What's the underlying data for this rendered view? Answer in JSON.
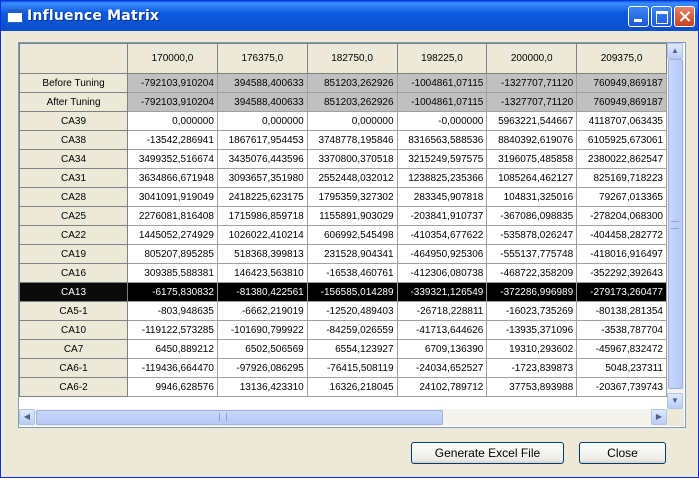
{
  "window": {
    "title": "Influence Matrix"
  },
  "columns": [
    "170000,0",
    "176375,0",
    "182750,0",
    "198225,0",
    "200000,0",
    "209375,0"
  ],
  "rows": [
    {
      "label": "Before Tuning",
      "values": [
        "-792103,910204",
        "394588,400633",
        "851203,262926",
        "-1004861,07115",
        "-1327707,71120",
        "760949,869187"
      ]
    },
    {
      "label": "After Tuning",
      "values": [
        "-792103,910204",
        "394588,400633",
        "851203,262926",
        "-1004861,07115",
        "-1327707,71120",
        "760949,869187"
      ]
    },
    {
      "label": "CA39",
      "values": [
        "0,000000",
        "0,000000",
        "0,000000",
        "-0,000000",
        "5963221,544667",
        "4118707,063435"
      ]
    },
    {
      "label": "CA38",
      "values": [
        "-13542,286941",
        "1867617,954453",
        "3748778,195846",
        "8316563,588536",
        "8840392,619076",
        "6105925,673061"
      ]
    },
    {
      "label": "CA34",
      "values": [
        "3499352,516674",
        "3435076,443596",
        "3370800,370518",
        "3215249,597575",
        "3196075,485858",
        "2380022,862547"
      ]
    },
    {
      "label": "CA31",
      "values": [
        "3634866,671948",
        "3093657,351980",
        "2552448,032012",
        "1238825,235366",
        "1085264,462127",
        "825169,718223"
      ]
    },
    {
      "label": "CA28",
      "values": [
        "3041091,919049",
        "2418225,623175",
        "1795359,327302",
        "283345,907818",
        "104831,325016",
        "79267,013365"
      ]
    },
    {
      "label": "CA25",
      "values": [
        "2276081,816408",
        "1715986,859718",
        "1155891,903029",
        "-203841,910737",
        "-367086,098835",
        "-278204,068300"
      ]
    },
    {
      "label": "CA22",
      "values": [
        "1445052,274929",
        "1026022,410214",
        "606992,545498",
        "-410354,677622",
        "-535878,026247",
        "-404458,282772"
      ]
    },
    {
      "label": "CA19",
      "values": [
        "805207,895285",
        "518368,399813",
        "231528,904341",
        "-464950,925306",
        "-555137,775748",
        "-418016,916497"
      ]
    },
    {
      "label": "CA16",
      "values": [
        "309385,588381",
        "146423,563810",
        "-16538,460761",
        "-412306,080738",
        "-468722,358209",
        "-352292,392643"
      ]
    },
    {
      "label": "CA13",
      "values": [
        "-6175,830832",
        "-81380,422561",
        "-156585,014289",
        "-339321,126549",
        "-372286,996989",
        "-279173,260477"
      ]
    },
    {
      "label": "CA5-1",
      "values": [
        "-803,948635",
        "-6662,219019",
        "-12520,489403",
        "-26718,228811",
        "-16023,735269",
        "-80138,281354"
      ]
    },
    {
      "label": "CA10",
      "values": [
        "-119122,573285",
        "-101690,799922",
        "-84259,026559",
        "-41713,644626",
        "-13935,371096",
        "-3538,787704"
      ]
    },
    {
      "label": "CA7",
      "values": [
        "6450,889212",
        "6502,506569",
        "6554,123927",
        "6709,136390",
        "19310,293602",
        "-45967,832472"
      ]
    },
    {
      "label": "CA6-1",
      "values": [
        "-119436,664470",
        "-97926,086295",
        "-76415,508119",
        "-24034,652527",
        "-1723,839873",
        "5048,237311"
      ]
    },
    {
      "label": "CA6-2",
      "values": [
        "9946,628576",
        "13136,423310",
        "16326,218045",
        "24102,789712",
        "37753,893988",
        "-20367,739743"
      ]
    }
  ],
  "selected_row": "CA13",
  "buttons": {
    "generate": "Generate Excel File",
    "close": "Close"
  }
}
